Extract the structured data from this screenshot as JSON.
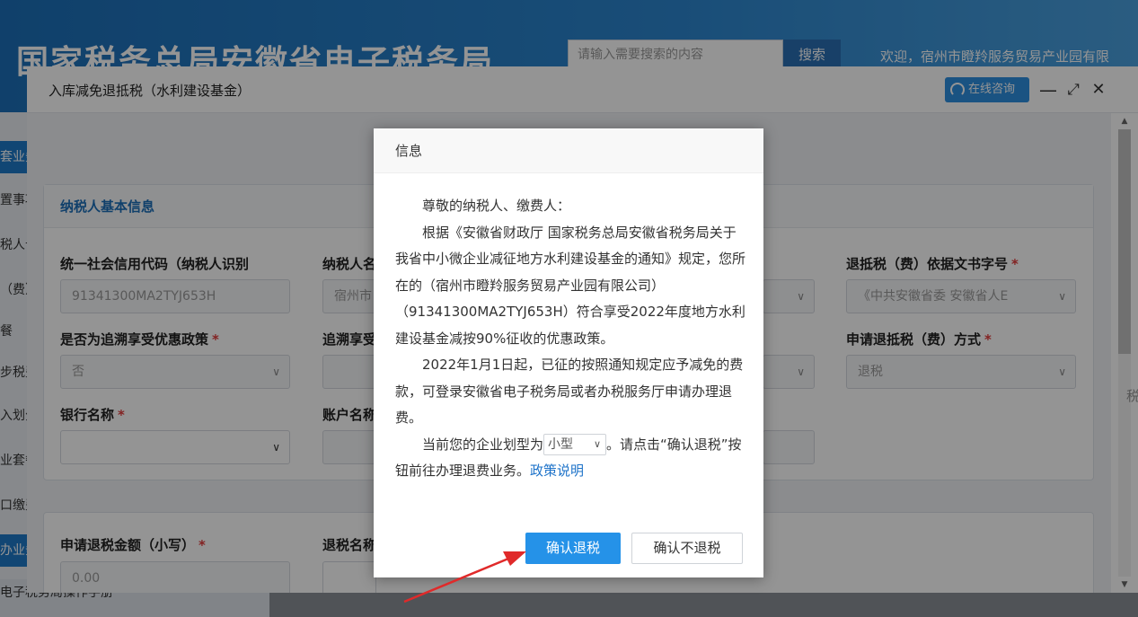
{
  "site": {
    "title": "国家税务总局安徽省电子税务局",
    "search_placeholder": "请输入需要搜索的内容",
    "search_button": "搜索",
    "welcome": "欢迎，宿州市瞪羚服务贸易产业园有限"
  },
  "sidebar": {
    "items": [
      "套业务",
      "置事项",
      "税人卡",
      "（费）",
      "餐",
      "步税费",
      "入划分",
      "业套餐",
      "口缴费",
      "办业务"
    ],
    "footer": "电子税务局操作手册"
  },
  "window": {
    "title": "入库减免退抵税（水利建设基金）",
    "consult_label": "在线咨询",
    "minimize": "—",
    "maximize": "⤢",
    "close": "✕"
  },
  "form": {
    "section_basic": "纳税人基本信息",
    "credit_code_label": "统一社会信用代码（纳税人识别",
    "credit_code_value": "91341300MA2TYJ653H",
    "taxpayer_name_label": "纳税人名",
    "taxpayer_name_value": "宿州市",
    "basis_doc_label": "退抵税（费）依据文书字号",
    "basis_doc_value": "《中共安徽省委 安徽省人E",
    "retro_label": "是否为追溯享受优惠政策",
    "retro_value": "否",
    "retro_period_label": "追溯享受",
    "refund_method_label": "申请退抵税（费）方式",
    "refund_method_value": "退税",
    "bank_label": "银行名称",
    "account_label": "账户名称",
    "amount_label": "申请退税金额（小写）",
    "amount_value": "0.00",
    "refund_name_label": "退税名称",
    "required_mark": "*",
    "edge_text": "税"
  },
  "dialog": {
    "title": "信息",
    "greeting": "尊敬的纳税人、缴费人：",
    "paragraph1": "根据《安徽省财政厅 国家税务总局安徽省税务局关于我省中小微企业减征地方水利建设基金的通知》规定，您所在的（宿州市瞪羚服务贸易产业园有限公司）（91341300MA2TYJ653H）符合享受2022年度地方水利建设基金减按90%征收的优惠政策。",
    "paragraph2": "2022年1月1日起，已征的按照通知规定应予减免的费款，可登录安徽省电子税务局或者办税服务厅申请办理退费。",
    "type_prefix": "当前您的企业划型为",
    "type_value": "小型",
    "type_suffix": "。请点击“确认退税”按钮前往办理退费业务。",
    "policy_link": "政策说明",
    "confirm_button": "确认退税",
    "cancel_button": "确认不退税"
  },
  "colors": {
    "brand": "#1c6fb8",
    "primary_button": "#2592e8",
    "required": "#e23b3b",
    "arrow": "#e02a2a"
  }
}
